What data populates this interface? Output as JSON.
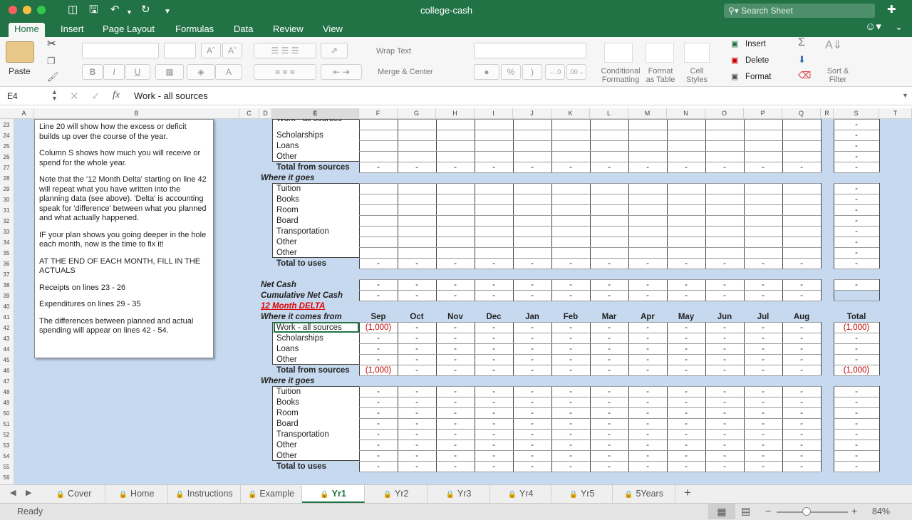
{
  "app": {
    "title": "college-cash",
    "search_placeholder": "Search Sheet"
  },
  "ribbon_tabs": [
    "Home",
    "Insert",
    "Page Layout",
    "Formulas",
    "Data",
    "Review",
    "View"
  ],
  "ribbon": {
    "paste": "Paste",
    "wrap_text": "Wrap Text",
    "merge_center": "Merge & Center",
    "conditional": "Conditional",
    "formatting": "Formatting",
    "format_as": "Format",
    "as_table": "as Table",
    "cell": "Cell",
    "styles": "Styles",
    "insert": "Insert",
    "delete": "Delete",
    "format": "Format",
    "sort": "Sort &",
    "filter": "Filter",
    "percent": "%",
    "comma": ")",
    "inc_dec": ".0\n.00"
  },
  "formula": {
    "cell_ref": "E4",
    "content": "Work - all sources",
    "fx": "fx"
  },
  "columns": [
    "A",
    "B",
    "C",
    "D",
    "E",
    "F",
    "G",
    "H",
    "I",
    "J",
    "K",
    "L",
    "M",
    "N",
    "O",
    "P",
    "Q",
    "R",
    "S",
    "T"
  ],
  "rows": [
    "23",
    "24",
    "25",
    "26",
    "27",
    "28",
    "29",
    "30",
    "31",
    "32",
    "33",
    "34",
    "35",
    "36",
    "37",
    "38",
    "39",
    "40",
    "41",
    "42",
    "43",
    "44",
    "45",
    "46",
    "47",
    "48",
    "49",
    "50",
    "51",
    "52",
    "53",
    "54",
    "55",
    "56"
  ],
  "textbox": [
    "Line 20 will show how the excess or deficit builds up over the course of the year.",
    "Column S shows how much you will receive or spend for the whole year.",
    "Note that the '12 Month Delta' starting on line 42 will repeat what you have written into the planning data (see above). 'Delta' is accounting speak for 'difference' between what you planned and what actually happened.",
    "IF your plan shows you going deeper in the hole each month, now is the time to fix it!",
    "AT THE END OF EACH MONTH, FILL IN THE ACTUALS",
    "Receipts on lines 23 - 26",
    "Expenditures on lines 29 - 35",
    "The differences between planned and actual spending will appear on lines 42 - 54."
  ],
  "labels": {
    "top_cut": "Work - all sources",
    "src_a": [
      "Scholarships",
      "Loans",
      "Other"
    ],
    "total_sources": "Total from sources",
    "where_goes": "Where it goes",
    "uses": [
      "Tuition",
      "Books",
      "Room",
      "Board",
      "Transportation",
      "Other",
      "Other"
    ],
    "total_uses": "Total to uses",
    "net_cash": "Net Cash",
    "cum_net_cash": "Cumulative Net Cash",
    "delta_title": "12 Month DELTA",
    "where_comes": "Where it comes from",
    "src_b": [
      "Work - all sources",
      "Scholarships",
      "Loans",
      "Other"
    ],
    "total_label": "Total"
  },
  "months": [
    "Sep",
    "Oct",
    "Nov",
    "Dec",
    "Jan",
    "Feb",
    "Mar",
    "Apr",
    "May",
    "Jun",
    "Jul",
    "Aug"
  ],
  "dash": "-",
  "negative_value": "(1,000)",
  "sheet_tabs": [
    "Cover",
    "Home",
    "Instructions",
    "Example",
    "Yr1",
    "Yr2",
    "Yr3",
    "Yr4",
    "Yr5",
    "5Years"
  ],
  "active_sheet": "Yr1",
  "status": {
    "ready": "Ready",
    "zoom": "84%"
  },
  "colors": {
    "accent": "#217346",
    "sheet_bg": "#c6d9ef",
    "negative": "#c00000",
    "delta_title": "#e00000"
  }
}
